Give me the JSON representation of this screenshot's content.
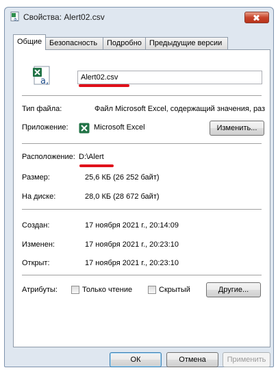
{
  "window": {
    "title": "Свойства: Alert02.csv"
  },
  "tabs": [
    {
      "label": "Общие"
    },
    {
      "label": "Безопасность"
    },
    {
      "label": "Подробно"
    },
    {
      "label": "Предыдущие версии"
    }
  ],
  "general": {
    "file_name": "Alert02.csv",
    "file_type_label": "Тип файла:",
    "file_type_value": "Файл Microsoft Excel, содержащий значения, раз",
    "app_label": "Приложение:",
    "app_value": "Microsoft Excel",
    "change_button": "Изменить...",
    "location_label": "Расположение:",
    "location_value": "D:\\Alert",
    "size_label": "Размер:",
    "size_value": "25,6 КБ (26 252 байт)",
    "disk_label": "На диске:",
    "disk_value": "28,0 КБ (28 672 байт)",
    "created_label": "Создан:",
    "created_value": "17 ноября 2021 г., 20:14:09",
    "modified_label": "Изменен:",
    "modified_value": "17 ноября 2021 г., 20:23:10",
    "opened_label": "Открыт:",
    "opened_value": "17 ноября 2021 г., 20:23:10",
    "attributes_label": "Атрибуты:",
    "readonly_label": "Только чтение",
    "readonly_checked": false,
    "hidden_label": "Скрытый",
    "hidden_checked": false,
    "other_button": "Другие..."
  },
  "footer": {
    "ok": "ОК",
    "cancel": "Отмена",
    "apply": "Применить"
  },
  "colors": {
    "annotation_red": "#e0101a",
    "excel_green": "#217346",
    "window_frame": "#dfe7f0"
  },
  "icons": {
    "title": "csv-file-icon",
    "file": "excel-csv-file-icon",
    "app": "excel-app-icon",
    "close": "close-icon"
  }
}
